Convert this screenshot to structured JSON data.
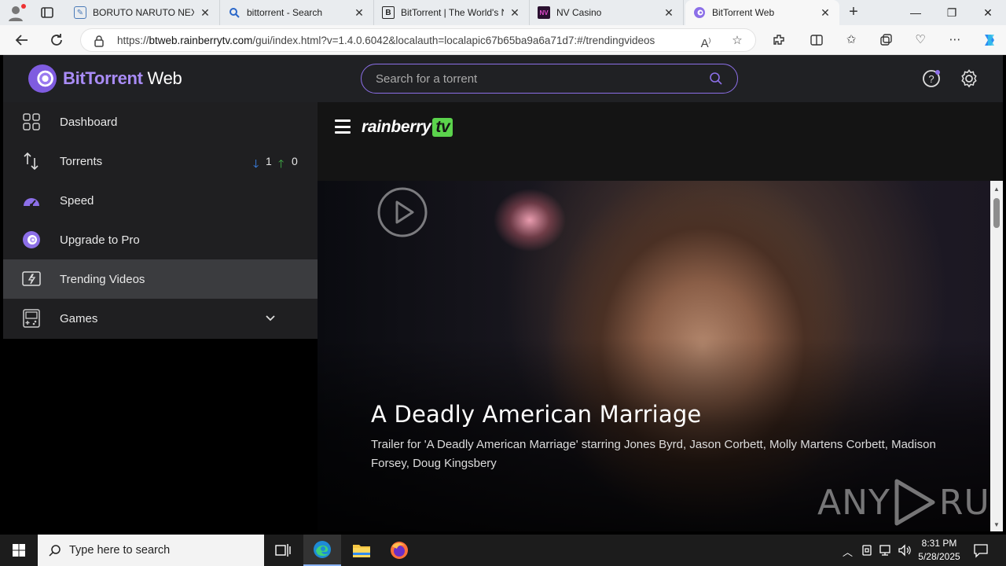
{
  "browser": {
    "tabs": [
      {
        "title": "BORUTO NARUTO NEXT G",
        "favicon": "page-icon"
      },
      {
        "title": "bittorrent - Search",
        "favicon": "search-icon"
      },
      {
        "title": "BitTorrent | The World's N",
        "favicon": "b-icon"
      },
      {
        "title": "NV Casino",
        "favicon": "nv-icon"
      },
      {
        "title": "BitTorrent Web",
        "favicon": "bittorrent-icon"
      }
    ],
    "url_prefix": "https://",
    "url_host": "btweb.rainberrytv.com",
    "url_path": "/gui/index.html?v=1.4.0.6042&localauth=localapic67b65ba9a6a71d7:#/trendingvideos"
  },
  "app": {
    "logo_bt": "BitTorrent",
    "logo_web": " Web",
    "search_placeholder": "Search for a torrent"
  },
  "sidebar": {
    "items": [
      {
        "label": "Dashboard"
      },
      {
        "label": "Torrents",
        "down_count": "1",
        "up_count": "0"
      },
      {
        "label": "Speed"
      },
      {
        "label": "Upgrade to Pro"
      },
      {
        "label": "Trending Videos"
      },
      {
        "label": "Games"
      }
    ]
  },
  "rainberry": {
    "logo": "rainberry",
    "logo_tv": "tv"
  },
  "hero": {
    "title": "A Deadly American Marriage",
    "description": "Trailer for 'A Deadly American Marriage' starring Jones Byrd, Jason Corbett, Molly Martens Corbett, Madison Forsey, Doug Kingsbery"
  },
  "watermark": {
    "left": "ANY",
    "right": "RUN"
  },
  "taskbar": {
    "search_placeholder": "Type here to search",
    "time": "8:31 PM",
    "date": "5/28/2025"
  },
  "colors": {
    "accent": "#8c6fe8",
    "download": "#3d8af7",
    "upload": "#43b649",
    "rainberry_green": "#5bd34c"
  }
}
